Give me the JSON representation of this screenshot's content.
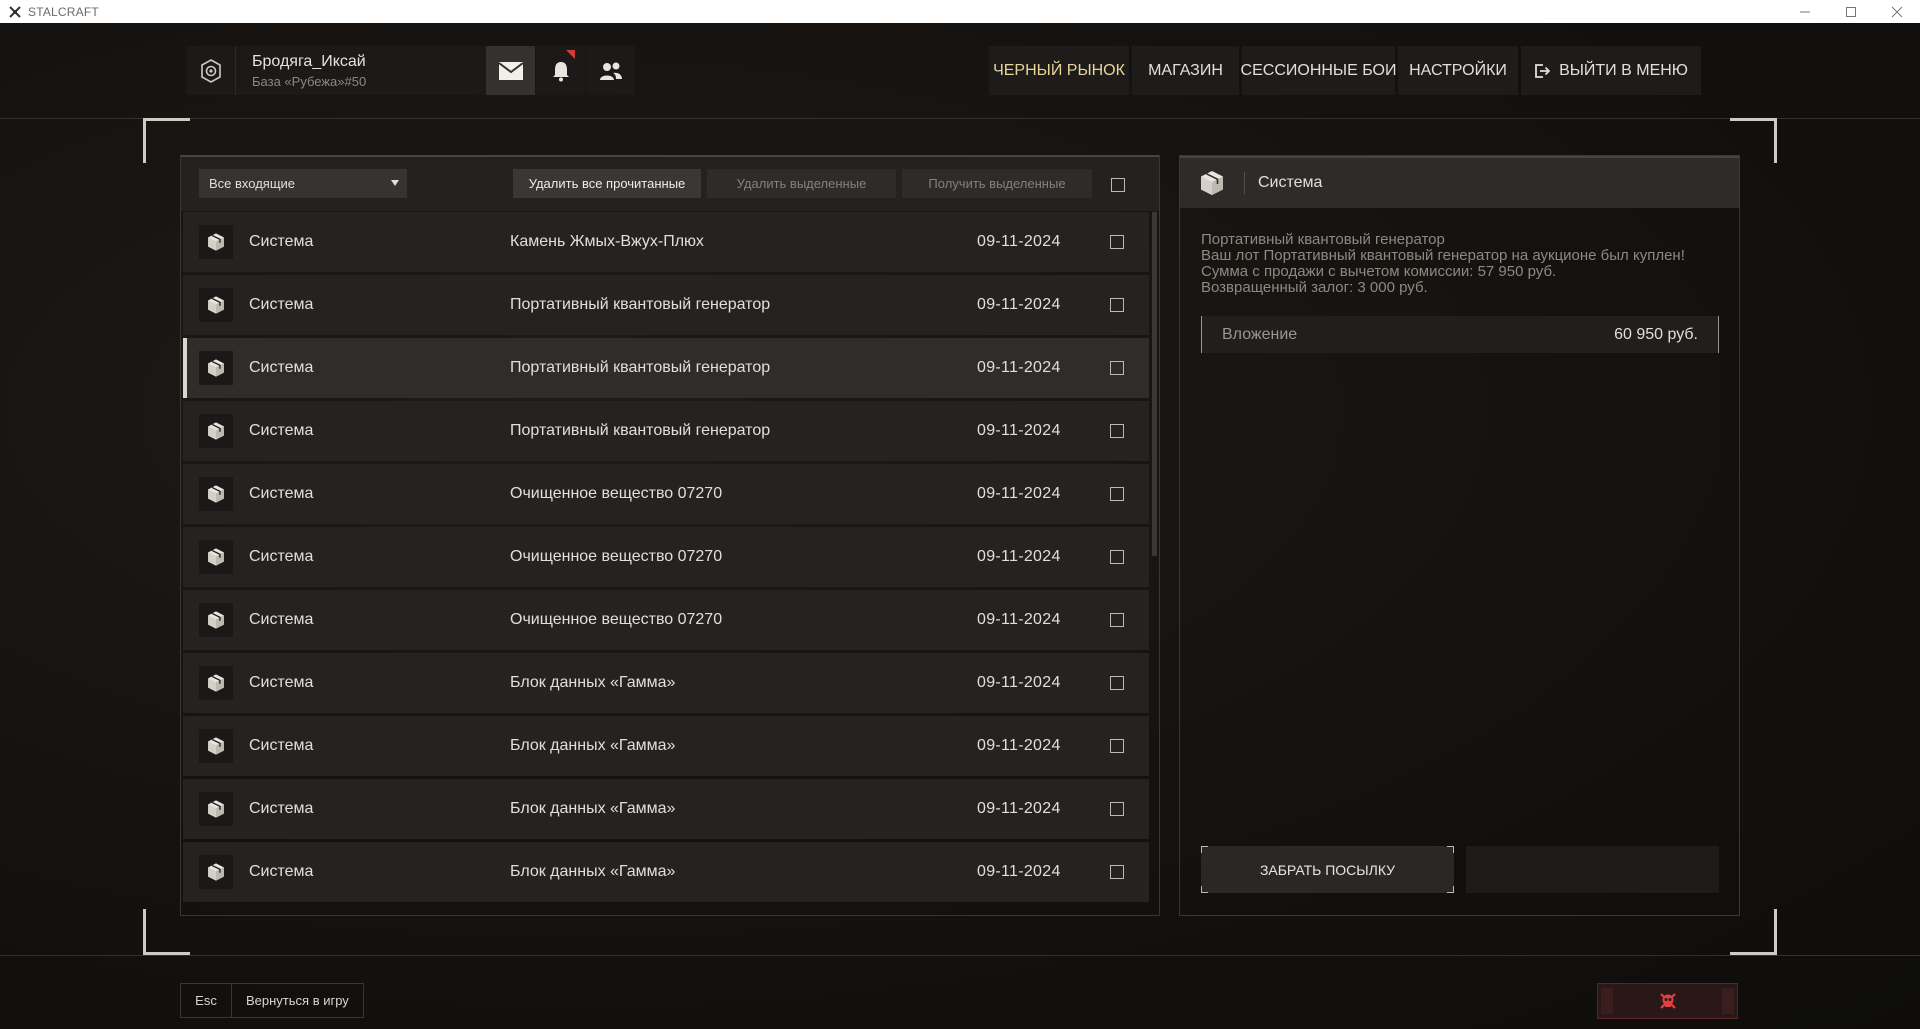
{
  "window": {
    "title": "STALCRAFT",
    "controls": [
      "minimize-icon",
      "maximize-icon",
      "close-icon"
    ]
  },
  "player": {
    "name": "Бродяга_Иксай",
    "base": "База «Рубежа»#50"
  },
  "header_icons": [
    "faction-emblem-icon",
    "mail-icon",
    "bell-icon",
    "friends-icon"
  ],
  "nav": {
    "black_market": "ЧЕРНЫЙ РЫНОК",
    "shop": "МАГАЗИН",
    "session_battles": "СЕССИОННЫЕ БОИ",
    "settings": "НАСТРОЙКИ",
    "exit_menu": "ВЫЙТИ В МЕНЮ"
  },
  "toolbar": {
    "filter_value": "Все входящие",
    "delete_read": "Удалить все прочитанные",
    "delete_selected": "Удалить выделенные",
    "get_selected": "Получить выделенные"
  },
  "messages": [
    {
      "sender": "Система",
      "subject": "Камень Жмых-Вжух-Плюх",
      "date": "09-11-2024"
    },
    {
      "sender": "Система",
      "subject": "Портативный квантовый генератор",
      "date": "09-11-2024"
    },
    {
      "sender": "Система",
      "subject": "Портативный квантовый генератор",
      "date": "09-11-2024",
      "selected": true
    },
    {
      "sender": "Система",
      "subject": "Портативный квантовый генератор",
      "date": "09-11-2024"
    },
    {
      "sender": "Система",
      "subject": "Очищенное вещество 07270",
      "date": "09-11-2024"
    },
    {
      "sender": "Система",
      "subject": "Очищенное вещество 07270",
      "date": "09-11-2024"
    },
    {
      "sender": "Система",
      "subject": "Очищенное вещество 07270",
      "date": "09-11-2024"
    },
    {
      "sender": "Система",
      "subject": "Блок данных «Гамма»",
      "date": "09-11-2024"
    },
    {
      "sender": "Система",
      "subject": "Блок данных «Гамма»",
      "date": "09-11-2024"
    },
    {
      "sender": "Система",
      "subject": "Блок данных «Гамма»",
      "date": "09-11-2024"
    },
    {
      "sender": "Система",
      "subject": "Блок данных «Гамма»",
      "date": "09-11-2024"
    }
  ],
  "detail": {
    "sender": "Система",
    "lines": [
      "Портативный квантовый генератор",
      "Ваш лот Портативный квантовый генератор на аукционе был куплен!",
      "Сумма с продажи с вычетом комиссии: 57 950 руб.",
      "Возвращенный залог: 3 000 руб."
    ],
    "attachment_label": "Вложение",
    "attachment_value": "60 950 руб.",
    "take_button": "ЗАБРАТЬ ПОСЫЛКУ"
  },
  "footer": {
    "esc_key": "Esc",
    "back_label": "Вернуться в игру"
  },
  "colors": {
    "accent_gold": "#e7d49a",
    "notification_red": "#d23b3b",
    "skull_red": "#e04040"
  }
}
